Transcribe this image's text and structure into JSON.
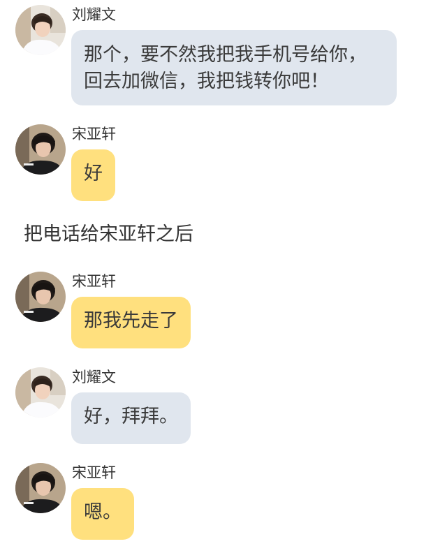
{
  "chat": {
    "messages": [
      {
        "sender": "刘耀文",
        "avatar_icon": "avatar-liu-yaowen-icon",
        "bubble_color": "#e0e6ee",
        "lines": [
          "那个，要不然我把我手机号给你，",
          "回去加微信，我把钱转你吧！"
        ]
      },
      {
        "sender": "宋亚轩",
        "avatar_icon": "avatar-song-yaxuan-icon",
        "bubble_color": "#ffe07e",
        "lines": [
          "好"
        ]
      },
      {
        "sender": "宋亚轩",
        "avatar_icon": "avatar-song-yaxuan-icon",
        "bubble_color": "#ffe07e",
        "lines": [
          "那我先走了"
        ]
      },
      {
        "sender": "刘耀文",
        "avatar_icon": "avatar-liu-yaowen-icon",
        "bubble_color": "#e0e6ee",
        "lines": [
          "好，拜拜。"
        ]
      },
      {
        "sender": "宋亚轩",
        "avatar_icon": "avatar-song-yaxuan-icon",
        "bubble_color": "#ffe07e",
        "lines": [
          "嗯。"
        ]
      }
    ],
    "narration": "把电话给宋亚轩之后"
  }
}
